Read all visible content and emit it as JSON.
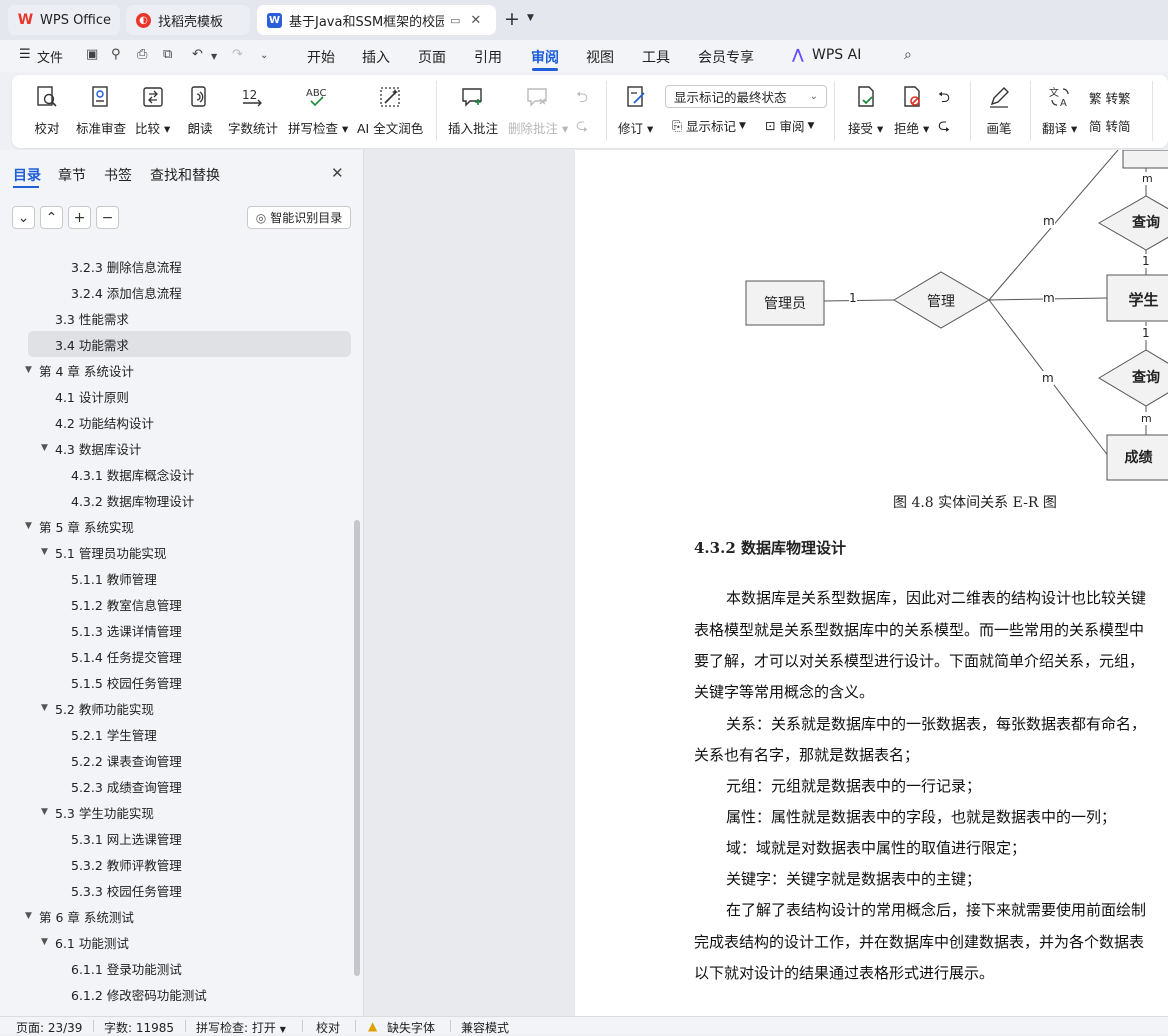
{
  "tabs": [
    {
      "label": "WPS Office",
      "active": false
    },
    {
      "label": "找稻壳模板",
      "active": false
    },
    {
      "label": "基于Java和SSM框架的校园教",
      "active": true
    }
  ],
  "menu": {
    "file": "文件",
    "items": [
      "开始",
      "插入",
      "页面",
      "引用",
      "审阅",
      "视图",
      "工具",
      "会员专享"
    ],
    "active": "审阅",
    "ai": "WPS AI"
  },
  "ribbon": {
    "proof": "校对",
    "std_review": "标准审查",
    "compare": "比较",
    "read": "朗读",
    "word_count": "字数统计",
    "spell": "拼写检查",
    "ai_polish": "AI 全文润色",
    "insert_comment": "插入批注",
    "delete_comment": "删除批注",
    "revise": "修订",
    "markup_select": "显示标记的最终状态",
    "show_markup": "显示标记",
    "review": "审阅",
    "accept": "接受",
    "reject": "拒绝",
    "pen": "画笔",
    "translate": "翻译",
    "to_trad": "转繁",
    "to_simp": "转简"
  },
  "panel": {
    "tabs": [
      "目录",
      "章节",
      "书签",
      "查找和替换"
    ],
    "active_tab": "目录",
    "smart_toc": "智能识别目录",
    "toc": [
      {
        "text": "3.2.3  删除信息流程",
        "level": 3,
        "arrow": false
      },
      {
        "text": "3.2.4  添加信息流程",
        "level": 3,
        "arrow": false
      },
      {
        "text": "3.3  性能需求",
        "level": 2,
        "arrow": false
      },
      {
        "text": "3.4  功能需求",
        "level": 2,
        "arrow": false,
        "selected": true
      },
      {
        "text": "第 4 章  系统设计",
        "level": 1,
        "arrow": true
      },
      {
        "text": "4.1  设计原则",
        "level": 2,
        "arrow": false
      },
      {
        "text": "4.2  功能结构设计",
        "level": 2,
        "arrow": false
      },
      {
        "text": "4.3  数据库设计",
        "level": 2,
        "arrow": true
      },
      {
        "text": "4.3.1  数据库概念设计",
        "level": 3,
        "arrow": false
      },
      {
        "text": "4.3.2  数据库物理设计",
        "level": 3,
        "arrow": false
      },
      {
        "text": "第 5 章  系统实现",
        "level": 1,
        "arrow": true
      },
      {
        "text": "5.1  管理员功能实现",
        "level": 2,
        "arrow": true
      },
      {
        "text": "5.1.1  教师管理",
        "level": 3,
        "arrow": false
      },
      {
        "text": "5.1.2  教室信息管理",
        "level": 3,
        "arrow": false
      },
      {
        "text": "5.1.3  选课详情管理",
        "level": 3,
        "arrow": false
      },
      {
        "text": "5.1.4  任务提交管理",
        "level": 3,
        "arrow": false
      },
      {
        "text": "5.1.5  校园任务管理",
        "level": 3,
        "arrow": false
      },
      {
        "text": "5.2  教师功能实现",
        "level": 2,
        "arrow": true
      },
      {
        "text": "5.2.1  学生管理",
        "level": 3,
        "arrow": false
      },
      {
        "text": "5.2.2  课表查询管理",
        "level": 3,
        "arrow": false
      },
      {
        "text": "5.2.3  成绩查询管理",
        "level": 3,
        "arrow": false
      },
      {
        "text": "5.3  学生功能实现",
        "level": 2,
        "arrow": true
      },
      {
        "text": "5.3.1  网上选课管理",
        "level": 3,
        "arrow": false
      },
      {
        "text": "5.3.2  教师评教管理",
        "level": 3,
        "arrow": false
      },
      {
        "text": "5.3.3  校园任务管理",
        "level": 3,
        "arrow": false
      },
      {
        "text": "第 6 章  系统测试",
        "level": 1,
        "arrow": true
      },
      {
        "text": "6.1  功能测试",
        "level": 2,
        "arrow": true
      },
      {
        "text": "6.1.1  登录功能测试",
        "level": 3,
        "arrow": false
      },
      {
        "text": "6.1.2  修改密码功能测试",
        "level": 3,
        "arrow": false
      }
    ]
  },
  "diagram": {
    "admin": "管理员",
    "manage": "管理",
    "student": "学生",
    "query1": "查询",
    "query2": "查询",
    "grade": "成绩",
    "card_1": "1",
    "card_m": "m",
    "caption": "图 4.8  实体间关系 E-R 图"
  },
  "document": {
    "heading": "4.3.2  数据库物理设计",
    "lines": [
      "本数据库是关系型数据库，因此对二维表的结构设计也比较关键",
      "表格模型就是关系型数据库中的关系模型。而一些常用的关系模型中",
      "要了解，才可以对关系模型进行设计。下面就简单介绍关系，元组，",
      "关键字等常用概念的含义。",
      "关系：关系就是数据库中的一张数据表，每张数据表都有命名，",
      "关系也有名字，那就是数据表名；",
      "元组：元组就是数据表中的一行记录；",
      "属性：属性就是数据表中的字段，也就是数据表中的一列；",
      "域：域就是对数据表中属性的取值进行限定；",
      "关键字：关键字就是数据表中的主键；",
      "在了解了表结构设计的常用概念后，接下来就需要使用前面绘制",
      "完成表结构的设计工作，并在数据库中创建数据表，并为各个数据表",
      "以下就对设计的结果通过表格形式进行展示。"
    ]
  },
  "status": {
    "page": "页面: 23/39",
    "words": "字数: 11985",
    "spell": "拼写检查: 打开",
    "proof": "校对",
    "missing_font": "缺失字体",
    "compat": "兼容模式"
  },
  "colors": {
    "accent": "#1e5fd9",
    "wps_red": "#e8362b",
    "tab_active": "#ffffff"
  }
}
